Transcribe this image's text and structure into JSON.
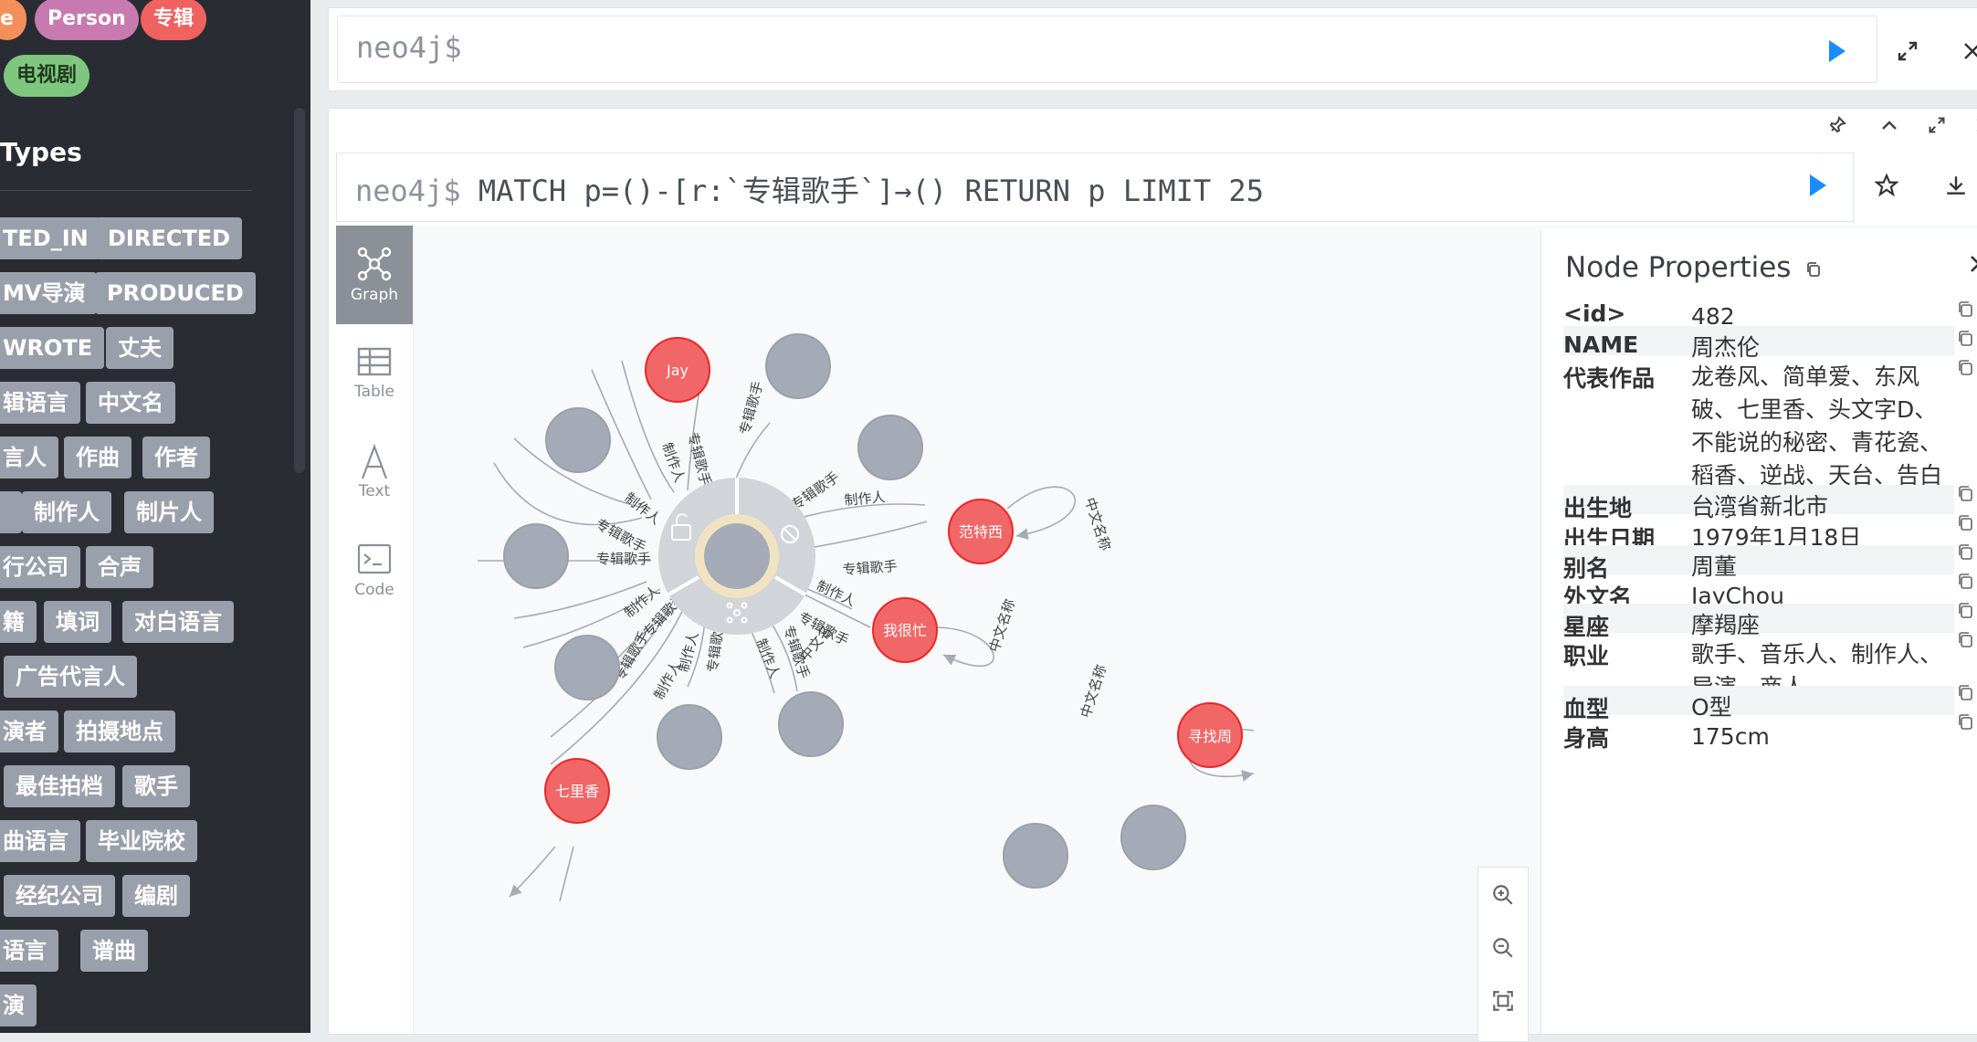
{
  "sidebar": {
    "node_labels": [
      {
        "label": "e",
        "color": "#f48f5c"
      },
      {
        "label": "Person",
        "color": "#c77ab0"
      },
      {
        "label": "专辑",
        "color": "#f0625f"
      },
      {
        "label": "电视剧",
        "color": "#7fc77f"
      }
    ],
    "types_title": "Types",
    "rel_types": [
      "TED_IN",
      "DIRECTED",
      "MV导演",
      "PRODUCED",
      "WROTE",
      "丈夫",
      "辑语言",
      "中文名",
      "言人",
      "作曲",
      "作者",
      "",
      "制作人",
      "制片人",
      "行公司",
      "合声",
      "籍",
      "填词",
      "对白语言",
      "广告代言人",
      "演者",
      "拍摄地点",
      "最佳拍档",
      "歌手",
      "曲语言",
      "毕业院校",
      "经纪公司",
      "编剧",
      "语言",
      "谱曲",
      "演"
    ]
  },
  "topbar": {
    "prompt": "neo4j$"
  },
  "query": {
    "prompt": "neo4j$",
    "text": " MATCH p=()-[r:`专辑歌手`]→() RETURN p LIMIT 25"
  },
  "views": [
    {
      "label": "Graph",
      "icon": "graph-icon"
    },
    {
      "label": "Table",
      "icon": "table-icon"
    },
    {
      "label": "Text",
      "icon": "text-icon"
    },
    {
      "label": "Code",
      "icon": "code-icon"
    }
  ],
  "graph": {
    "nodes": [
      "Jay",
      "范特西",
      "我很忙",
      "七里香",
      "寻找周"
    ],
    "rel_labels": [
      "制作人",
      "专辑歌手",
      "中文名称",
      "中文名"
    ]
  },
  "props": {
    "title": "Node Properties",
    "rows": [
      {
        "key": "<id>",
        "value": "482"
      },
      {
        "key": "NAME",
        "value": "周杰伦"
      },
      {
        "key": "代表作品",
        "value": "龙卷风、简单爱、东风破、七里香、头文字D、不能说的秘密、青花瓷、稻香、逆战、天台、告白气球"
      },
      {
        "key": "出生地",
        "value": "台湾省新北市"
      },
      {
        "key": "出生日期",
        "value": "1979年1月18日"
      },
      {
        "key": "别名",
        "value": "周董"
      },
      {
        "key": "外文名",
        "value": "JayChou"
      },
      {
        "key": "星座",
        "value": "摩羯座"
      },
      {
        "key": "职业",
        "value": "歌手、音乐人、制作人、导演、商人"
      },
      {
        "key": "血型",
        "value": "O型"
      },
      {
        "key": "身高",
        "value": "175cm"
      }
    ]
  },
  "colors": {
    "accent": "#1a8cff",
    "red_node": "#f16667",
    "grey_node": "#a5abb6"
  }
}
